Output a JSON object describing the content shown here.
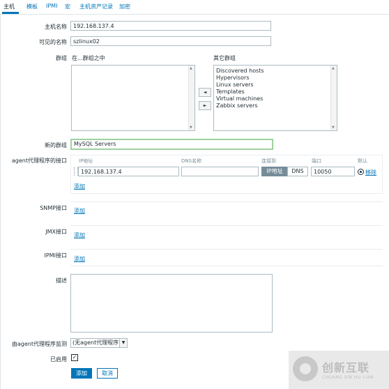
{
  "tabs": [
    "主机",
    "模板",
    "IPMI",
    "宏",
    "主机资产记录",
    "加密"
  ],
  "form": {
    "host_name_label": "主机名称",
    "host_name_value": "192.168.137.4",
    "visible_name_label": "可见的名称",
    "visible_name_value": "szlinux02",
    "groups_label": "群组",
    "in_groups_label": "在...群组之中",
    "other_groups_label": "其它群组",
    "other_groups": [
      "Discovered hosts",
      "Hypervisors",
      "Linux servers",
      "Templates",
      "Virtual machines",
      "Zabbix servers"
    ],
    "move_left_symbol": "◄",
    "move_right_symbol": "►",
    "new_group_label": "新的群组",
    "new_group_value": "MySQL Servers",
    "agent_iface_label": "agent代理程序的接口",
    "iface_headers": {
      "ip": "IP地址",
      "dns": "DNS名称",
      "connect": "连接到",
      "port": "端口",
      "default": "默认"
    },
    "agent_ip": "192.168.137.4",
    "agent_dns": "",
    "connect_ip": "IP地址",
    "connect_dns": "DNS",
    "agent_port": "10050",
    "remove_link": "移除",
    "add_link": "添加",
    "snmp_label": "SNMP接口",
    "jmx_label": "JMX接口",
    "ipmi_label": "IPMI接口",
    "description_label": "描述",
    "proxy_label": "由agent代理程序监测",
    "proxy_value": "(无agent代理程序)",
    "enabled_label": "已启用",
    "enabled_check": "✓",
    "add_button": "添加",
    "cancel_button": "取消"
  },
  "watermark": {
    "title": "创新互联",
    "subtitle": "CHUANG XIN HU LIAN"
  },
  "colors": {
    "accent": "#0275b8",
    "segment_on": "#768d99",
    "new_group_border": "#9ed19e"
  }
}
